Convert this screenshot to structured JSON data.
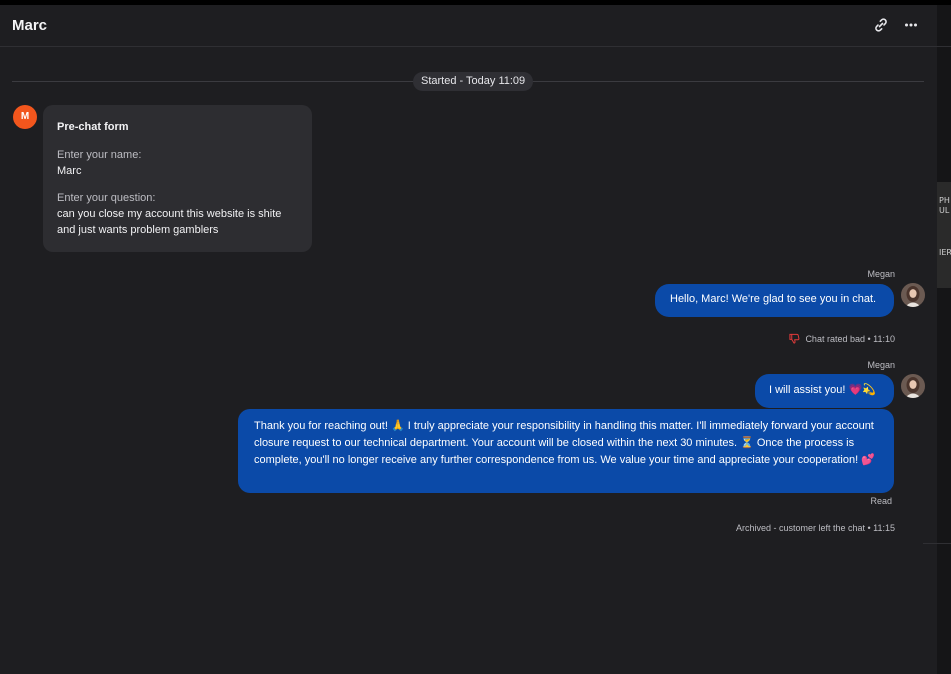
{
  "header": {
    "title": "Marc",
    "icons": [
      "link-icon",
      "more-icon"
    ]
  },
  "divider": {
    "started_label": "Started - Today 11:09"
  },
  "customer": {
    "avatar_initial": "M",
    "prechat": {
      "title": "Pre-chat form",
      "name_label": "Enter your name:",
      "name_value": "Marc",
      "question_label": "Enter your question:",
      "question_value": "can you close my account this website is shite and just wants problem gamblers"
    }
  },
  "messages": [
    {
      "sender": "Megan",
      "text": "Hello, Marc! We're glad to see you in chat."
    },
    {
      "sender": "Megan",
      "text": "I will assist you! 💗💫"
    },
    {
      "sender": "",
      "text": "Thank you for reaching out! 🙏 I truly appreciate your responsibility in handling this matter. I'll immediately forward your account closure request to our technical department. Your account will be closed within the next 30 minutes. ⏳ Once the process is complete, you'll no longer receive any further correspondence from us. We value your time and appreciate your cooperation! 💕"
    }
  ],
  "events": {
    "rating": "Chat rated bad • 11:10",
    "read_status": "Read",
    "archived": "Archived - customer left the chat • 11:15"
  },
  "sidebar_fragments": [
    "PH",
    "UL",
    "IER"
  ],
  "colors": {
    "panel_bg": "#1e1e21",
    "agent_bubble": "#0b4aa8",
    "form_card": "#2d2d31",
    "customer_avatar": "#f2561d",
    "bad_rating": "#e03a3a"
  }
}
